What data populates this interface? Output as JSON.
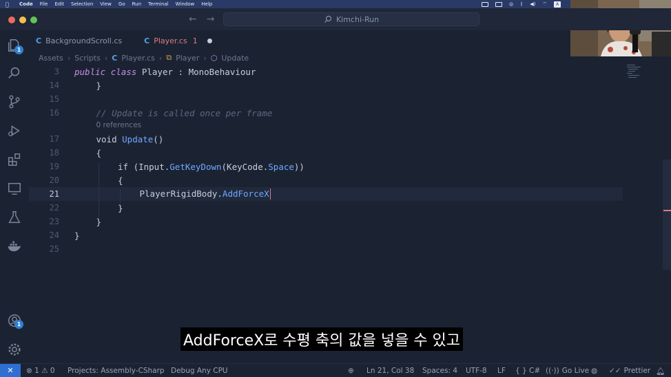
{
  "menubar": {
    "items": [
      "Code",
      "File",
      "Edit",
      "Selection",
      "View",
      "Go",
      "Run",
      "Terminal",
      "Window",
      "Help"
    ],
    "input_indicator": "A"
  },
  "titlebar": {
    "command_center": "Kimchi-Run"
  },
  "activity_bar": {
    "explorer_badge": "1",
    "account_badge": "1"
  },
  "tabs": [
    {
      "label": "BackgroundScroll.cs",
      "active": false
    },
    {
      "label": "Player.cs",
      "active": true,
      "modified_count": "1"
    }
  ],
  "breadcrumb": [
    "Assets",
    "Scripts",
    "Player.cs",
    "Player",
    "Update"
  ],
  "editor": {
    "lines": [
      {
        "n": "3",
        "tokens": [
          [
            "kw",
            "public"
          ],
          [
            "kw2",
            " "
          ],
          [
            "kw",
            "class"
          ],
          [
            "kw2",
            " Player : MonoBehaviour"
          ]
        ],
        "indent": 0
      },
      {
        "n": "14",
        "tokens": [
          [
            "kw2",
            "}"
          ]
        ],
        "indent": 1
      },
      {
        "n": "15",
        "tokens": [],
        "indent": 0
      },
      {
        "n": "16",
        "tokens": [
          [
            "cmt",
            "// Update is called once per frame"
          ]
        ],
        "indent": 1
      },
      {
        "refs": "0 references",
        "indent": 1
      },
      {
        "n": "17",
        "tokens": [
          [
            "kw2",
            "void "
          ],
          [
            "fn",
            "Update"
          ],
          [
            "kw2",
            "()"
          ]
        ],
        "indent": 1
      },
      {
        "n": "18",
        "tokens": [
          [
            "kw2",
            "{"
          ]
        ],
        "indent": 1
      },
      {
        "n": "19",
        "tokens": [
          [
            "kw2",
            "if ("
          ],
          [
            "kw2",
            "Input."
          ],
          [
            "fn",
            "GetKeyDown"
          ],
          [
            "kw2",
            "(KeyCode."
          ],
          [
            "prop",
            "Space"
          ],
          [
            "kw2",
            "))"
          ]
        ],
        "indent": 2
      },
      {
        "n": "20",
        "tokens": [
          [
            "kw2",
            "{"
          ]
        ],
        "indent": 2
      },
      {
        "n": "21",
        "tokens": [
          [
            "kw2",
            "PlayerRigidBody."
          ],
          [
            "fn",
            "AddForceX"
          ]
        ],
        "indent": 3,
        "current": true
      },
      {
        "n": "22",
        "tokens": [
          [
            "kw2",
            "}"
          ]
        ],
        "indent": 2
      },
      {
        "n": "23",
        "tokens": [
          [
            "kw2",
            "}"
          ]
        ],
        "indent": 1
      },
      {
        "n": "24",
        "tokens": [
          [
            "kw2",
            "}"
          ]
        ],
        "indent": 0
      },
      {
        "n": "25",
        "tokens": [],
        "indent": 0
      }
    ]
  },
  "subtitle": "AddForceX로 수평 축의 값을 넣을 수 있고",
  "statusbar": {
    "problems": "⊗ 1 ⚠ 0",
    "project": "Projects: Assembly-CSharp",
    "debug": "Debug Any CPU",
    "position": "Ln 21, Col 38",
    "spaces": "Spaces: 4",
    "encoding": "UTF-8",
    "eol": "LF",
    "language": "{ } C#",
    "golive": "Go Live",
    "prettier": "Prettier"
  },
  "colors": {
    "accent": "#2f6fd1",
    "modified": "#e07a86",
    "background": "#1b2333"
  }
}
